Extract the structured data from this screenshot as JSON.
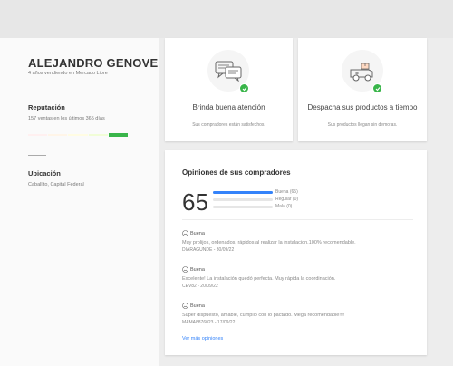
{
  "seller": {
    "name": "ALEJANDRO GENOVE",
    "subtitle": "4 años vendiendo en Mercado Libre"
  },
  "reputation": {
    "title": "Reputación",
    "sales_text": "157 ventas en los últimos 365 días",
    "level_colors": [
      "#fff0f0",
      "#fff5e8",
      "#fffce3",
      "#f1fdd7",
      "#39b54a"
    ],
    "active_level": 5
  },
  "location": {
    "title": "Ubicación",
    "text": "Caballito, Capital Federal"
  },
  "features": [
    {
      "icon": "chat-bubbles-icon",
      "title": "Brinda buena atención",
      "subtitle": "Sus compradores están satisfechos."
    },
    {
      "icon": "delivery-truck-icon",
      "title": "Despacha sus productos a tiempo",
      "subtitle": "Sus productos llegan sin demoras."
    }
  ],
  "opinions": {
    "title": "Opiniones de sus compradores",
    "score": "65",
    "bars": [
      {
        "label": "Buena (65)",
        "fraction": 1.0
      },
      {
        "label": "Regular (0)",
        "fraction": 0
      },
      {
        "label": "Mala (0)",
        "fraction": 0
      }
    ],
    "reviews": [
      {
        "rating": "Buena",
        "text": "Muy prolijos, ordenados, rápidos al realizar la instalacion.100% recomendable.",
        "user": "DIARAGUNDE - 30/09/22"
      },
      {
        "rating": "Buena",
        "text": "Excelente! La instalación quedó perfecta. Muy rápida la coordinación.",
        "user": "CEV82 - 20/09/22"
      },
      {
        "rating": "Buena",
        "text": "Super dispuesto, amable, cumplió con lo pactado. Mega recomendable!!!!",
        "user": "MAMA8876023 - 17/09/22"
      }
    ],
    "more_link": "Ver más opiniones"
  },
  "colors": {
    "accent": "#3483fa",
    "success": "#39b54a"
  }
}
